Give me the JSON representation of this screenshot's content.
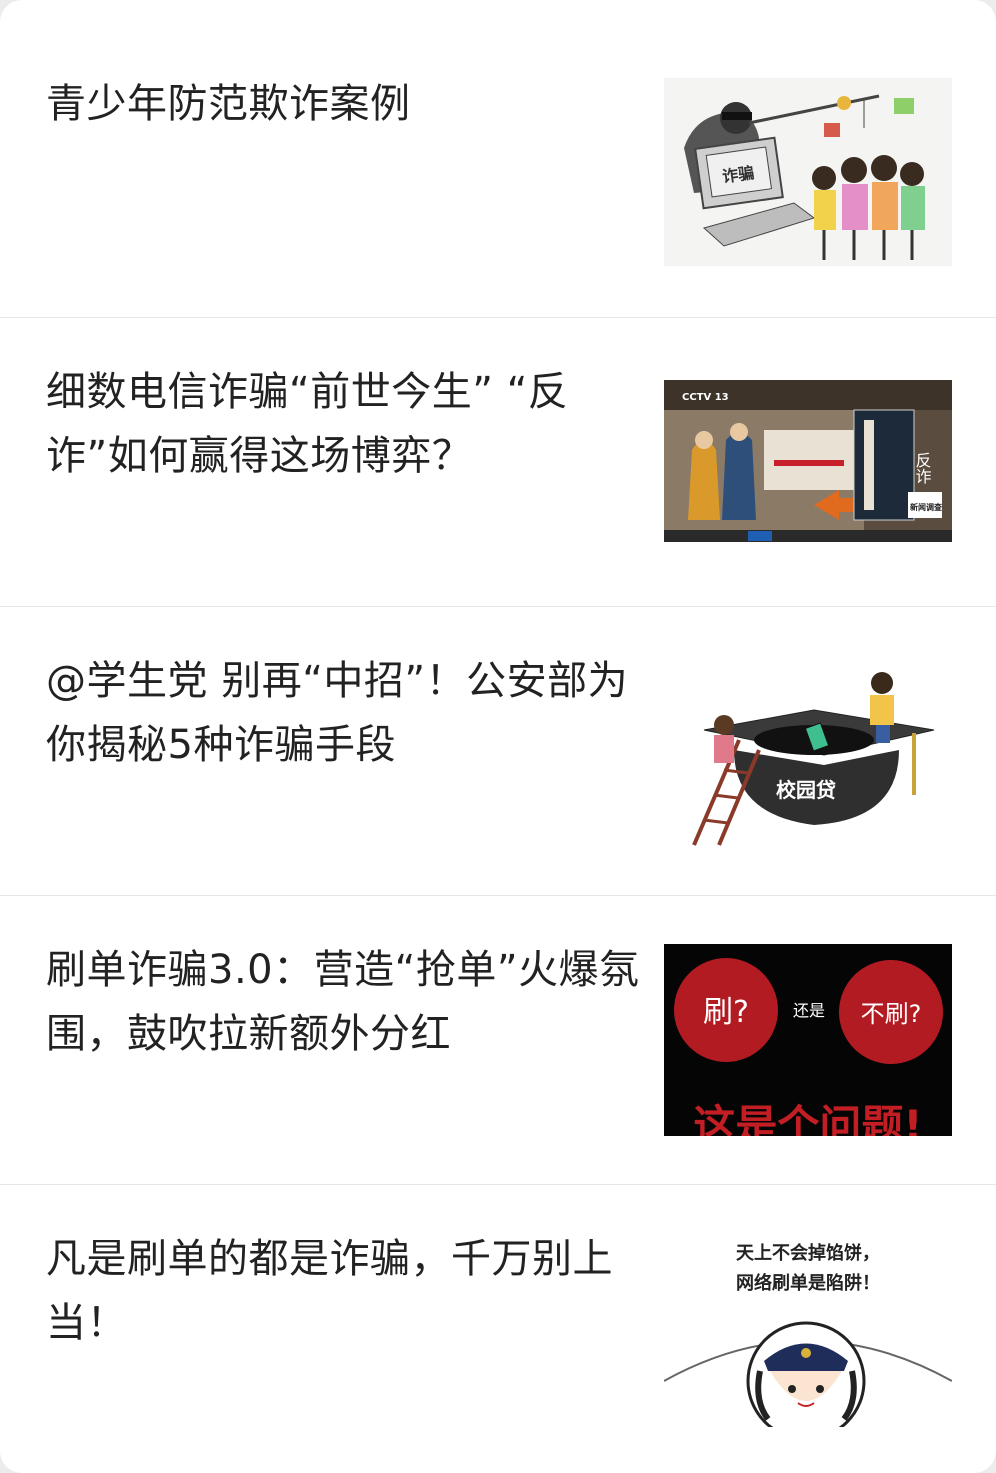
{
  "articles": [
    {
      "title": "青少年防范欺诈案例",
      "thumbnail": {
        "icon": "cartoon-fraud-illustration",
        "screen_text": "诈骗"
      }
    },
    {
      "title": "细数电信诈骗“前世今生” “反诈”如何赢得这场博弈？",
      "thumbnail": {
        "icon": "cctv-news-screenshot",
        "logo": "CCTV 13",
        "vertical_text": "反诈",
        "badge": "新闻调查"
      }
    },
    {
      "title": "@学生党 别再“中招”！公安部为你揭秘5种诈骗手段",
      "thumbnail": {
        "icon": "campus-loan-illustration",
        "cap_text": "校园贷"
      }
    },
    {
      "title": "刷单诈骗3.0：营造“抢单”火爆氛围，鼓吹拉新额外分红",
      "thumbnail": {
        "icon": "shuadan-question-graphic",
        "left_circle": "刷?",
        "middle": "还是",
        "right_circle": "不刷?",
        "bottom": "这是个问题!"
      }
    },
    {
      "title": "凡是刷单的都是诈骗，千万别上当！",
      "thumbnail": {
        "icon": "police-cartoon",
        "line1": "天上不会掉馅饼，",
        "line2": "网络刷单是陷阱！"
      }
    }
  ],
  "colors": {
    "background": "#ffffff",
    "divider": "#e6e6e6",
    "title_text": "#222222",
    "accent_red": "#c8202a"
  }
}
